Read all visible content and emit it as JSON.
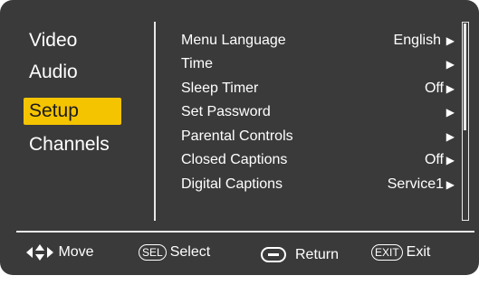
{
  "left_menu": {
    "items": [
      {
        "label": "Video"
      },
      {
        "label": "Audio"
      },
      {
        "label": "Setup",
        "active": true
      },
      {
        "label": "Channels"
      }
    ]
  },
  "setup_menu": {
    "rows": [
      {
        "label": "Menu Language",
        "value": "English",
        "arrow": "▶"
      },
      {
        "label": "Time",
        "value": "",
        "arrow": "▶"
      },
      {
        "label": "Sleep Timer",
        "value": "Off",
        "arrow": "▶"
      },
      {
        "label": "Set Password",
        "value": "",
        "arrow": "▶"
      },
      {
        "label": "Parental Controls",
        "value": "",
        "arrow": "▶"
      },
      {
        "label": "Closed Captions",
        "value": "Off",
        "arrow": "▶"
      },
      {
        "label": "Digital Captions",
        "value": "Service1",
        "arrow": "▶"
      }
    ]
  },
  "footer": {
    "move_label": "Move",
    "move_icon": "◀▲▼▶",
    "select_key": "SEL",
    "select_label": "Select",
    "return_label": "Return",
    "exit_key": "EXIT",
    "exit_label": "Exit"
  },
  "colors": {
    "background": "#3a3a3a",
    "highlight": "#f5c400",
    "text": "#ffffff"
  }
}
